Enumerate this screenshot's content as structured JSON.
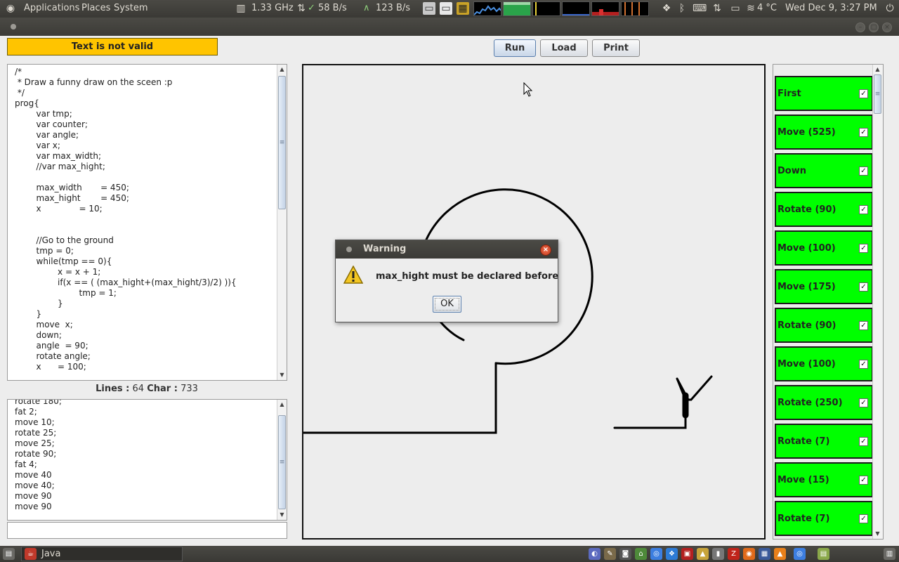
{
  "top_panel": {
    "menus": [
      "Applications",
      "Places",
      "System"
    ],
    "cpu_freq": "1.33 GHz",
    "net_down": "58 B/s",
    "net_up": "123 B/s",
    "weather": "4 °C",
    "clock": "Wed Dec  9,  3:27 PM"
  },
  "toolbar": {
    "status_text": "Text is not valid",
    "run_label": "Run",
    "load_label": "Load",
    "print_label": "Print"
  },
  "editor": {
    "source_code": "/*\n * Draw a funny draw on the sceen :p\n */\nprog{\n\tvar tmp;\n\tvar counter;\n\tvar angle;\n\tvar x;\n\tvar max_width;\n\t//var max_hight;\n\n\tmax_width\t= 450;\n\tmax_hight\t= 450;\n\tx\t\t= 10;\n\n\n\t//Go to the ground\n\ttmp = 0;\n\twhile(tmp == 0){\n\t\tx = x + 1;\n\t\tif(x == ( (max_hight+(max_hight/3)/2) )){\n\t\t\ttmp = 1;\n\t\t}\n\t}\n\tmove  x;\n\tdown;\n\tangle  = 90;\n\trotate angle;\n\tx\t= 100;",
    "lines_label": "Lines :",
    "lines_count": "64",
    "char_label": "Char :",
    "char_count": "733"
  },
  "output": {
    "text": "rotate 180;\nfat 2;\nmove 10;\nrotate 25;\nmove 25;\nrotate 90;\nfat 4;\nmove 40\nmove 40;\nmove 90\nmove 90"
  },
  "input_field": {
    "value": ""
  },
  "commands": [
    {
      "label": "First",
      "checked": true
    },
    {
      "label": "Move (525)",
      "checked": true
    },
    {
      "label": "Down",
      "checked": true
    },
    {
      "label": "Rotate (90)",
      "checked": true
    },
    {
      "label": "Move (100)",
      "checked": true
    },
    {
      "label": "Move (175)",
      "checked": true
    },
    {
      "label": "Rotate (90)",
      "checked": true
    },
    {
      "label": "Move (100)",
      "checked": true
    },
    {
      "label": "Rotate (250)",
      "checked": true
    },
    {
      "label": "Rotate (7)",
      "checked": true
    },
    {
      "label": "Move (15)",
      "checked": true
    },
    {
      "label": "Rotate (7)",
      "checked": true
    }
  ],
  "dialog": {
    "title": "Warning",
    "message": "max_hight must be declared before",
    "ok_label": "OK"
  },
  "bottom_panel": {
    "task_label": "Java"
  },
  "colors": {
    "status_banner": "#ffc400",
    "command_item": "#00ff00",
    "panel": "#3c3b37"
  }
}
